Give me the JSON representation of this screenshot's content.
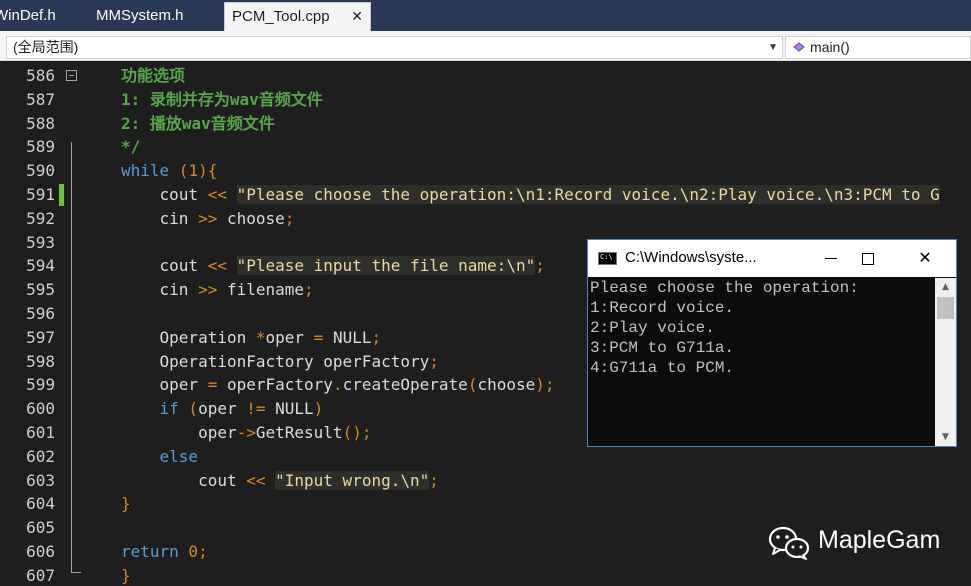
{
  "tabs": [
    {
      "label": "WinDef.h",
      "active": false
    },
    {
      "label": "MMSystem.h",
      "active": false
    },
    {
      "label": "PCM_Tool.cpp",
      "active": true
    }
  ],
  "navbar": {
    "scope": "(全局范围)",
    "member": "main()"
  },
  "code_lines": [
    {
      "number": "586",
      "tokens": [
        {
          "t": "功能选项",
          "c": "c-cmt"
        }
      ]
    },
    {
      "number": "587",
      "tokens": [
        {
          "t": "1: 录制并存为wav音频文件",
          "c": "c-cmt"
        }
      ]
    },
    {
      "number": "588",
      "tokens": [
        {
          "t": "2: 播放wav音频文件",
          "c": "c-cmt"
        }
      ]
    },
    {
      "number": "589",
      "tokens": [
        {
          "t": "*/",
          "c": "c-cmt"
        }
      ]
    },
    {
      "number": "590",
      "tokens": [
        {
          "t": "while",
          "c": "c-kw"
        },
        {
          "t": " (",
          "c": "c-op"
        },
        {
          "t": "1",
          "c": "c-num"
        },
        {
          "t": "){",
          "c": "c-op"
        }
      ]
    },
    {
      "number": "591",
      "tokens": [
        {
          "t": "    cout",
          "c": "c-id"
        },
        {
          "t": " << ",
          "c": "c-op"
        },
        {
          "t": "\"Please choose the operation:\\n1:Record voice.\\n2:Play voice.\\n3:PCM to G",
          "c": "c-str"
        }
      ]
    },
    {
      "number": "592",
      "tokens": [
        {
          "t": "    cin",
          "c": "c-id"
        },
        {
          "t": " >> ",
          "c": "c-op"
        },
        {
          "t": "choose",
          "c": "c-id"
        },
        {
          "t": ";",
          "c": "c-op"
        }
      ]
    },
    {
      "number": "593",
      "tokens": []
    },
    {
      "number": "594",
      "tokens": [
        {
          "t": "    cout",
          "c": "c-id"
        },
        {
          "t": " << ",
          "c": "c-op"
        },
        {
          "t": "\"Please input the file name:\\n\"",
          "c": "c-str"
        },
        {
          "t": ";",
          "c": "c-op"
        }
      ]
    },
    {
      "number": "595",
      "tokens": [
        {
          "t": "    cin",
          "c": "c-id"
        },
        {
          "t": " >> ",
          "c": "c-op"
        },
        {
          "t": "filename",
          "c": "c-id"
        },
        {
          "t": ";",
          "c": "c-op"
        }
      ]
    },
    {
      "number": "596",
      "tokens": []
    },
    {
      "number": "597",
      "tokens": [
        {
          "t": "    Operation",
          "c": "c-id"
        },
        {
          "t": " *",
          "c": "c-op"
        },
        {
          "t": "oper",
          "c": "c-id"
        },
        {
          "t": " = ",
          "c": "c-op"
        },
        {
          "t": "NULL",
          "c": "c-id"
        },
        {
          "t": ";",
          "c": "c-op"
        }
      ]
    },
    {
      "number": "598",
      "tokens": [
        {
          "t": "    OperationFactory operFactory",
          "c": "c-id"
        },
        {
          "t": ";",
          "c": "c-op"
        }
      ]
    },
    {
      "number": "599",
      "tokens": [
        {
          "t": "    oper",
          "c": "c-id"
        },
        {
          "t": " = ",
          "c": "c-op"
        },
        {
          "t": "operFactory",
          "c": "c-id"
        },
        {
          "t": ".",
          "c": "c-op"
        },
        {
          "t": "createOperate",
          "c": "c-fn"
        },
        {
          "t": "(",
          "c": "c-op"
        },
        {
          "t": "choose",
          "c": "c-id"
        },
        {
          "t": ");",
          "c": "c-op"
        }
      ]
    },
    {
      "number": "600",
      "tokens": [
        {
          "t": "    if",
          "c": "c-kw"
        },
        {
          "t": " (",
          "c": "c-op"
        },
        {
          "t": "oper",
          "c": "c-id"
        },
        {
          "t": " != ",
          "c": "c-op"
        },
        {
          "t": "NULL",
          "c": "c-id"
        },
        {
          "t": ")",
          "c": "c-op"
        }
      ]
    },
    {
      "number": "601",
      "tokens": [
        {
          "t": "        oper",
          "c": "c-id"
        },
        {
          "t": "->",
          "c": "c-op"
        },
        {
          "t": "GetResult",
          "c": "c-fn"
        },
        {
          "t": "();",
          "c": "c-op"
        }
      ]
    },
    {
      "number": "602",
      "tokens": [
        {
          "t": "    else",
          "c": "c-kw"
        }
      ]
    },
    {
      "number": "603",
      "tokens": [
        {
          "t": "        cout",
          "c": "c-id"
        },
        {
          "t": " << ",
          "c": "c-op"
        },
        {
          "t": "\"Input wrong.\\n\"",
          "c": "c-str"
        },
        {
          "t": ";",
          "c": "c-op"
        }
      ]
    },
    {
      "number": "604",
      "tokens": [
        {
          "t": "}",
          "c": "c-op"
        }
      ]
    },
    {
      "number": "605",
      "tokens": []
    },
    {
      "number": "606",
      "tokens": [
        {
          "t": "return",
          "c": "c-kw"
        },
        {
          "t": " 0",
          "c": "c-num"
        },
        {
          "t": ";",
          "c": "c-op"
        }
      ]
    },
    {
      "number": "607",
      "tokens": [
        {
          "t": "}",
          "c": "c-op"
        }
      ]
    }
  ],
  "console": {
    "title": "C:\\Windows\\syste...",
    "icon_text": "C:\\",
    "lines": [
      "Please choose the operation:",
      "1:Record voice.",
      "2:Play voice.",
      "3:PCM to G711a.",
      "4:G711a to PCM."
    ]
  },
  "watermark": {
    "text": "MapleGam",
    "icon": "wechat-icon"
  },
  "colors": {
    "tab_bar": "#293955",
    "editor_bg": "#1e1e1e",
    "comment": "#57a64a",
    "keyword": "#569cd6",
    "operator": "#d68a1e",
    "string": "#ead9a0",
    "modified_marker": "#6fc13e"
  }
}
